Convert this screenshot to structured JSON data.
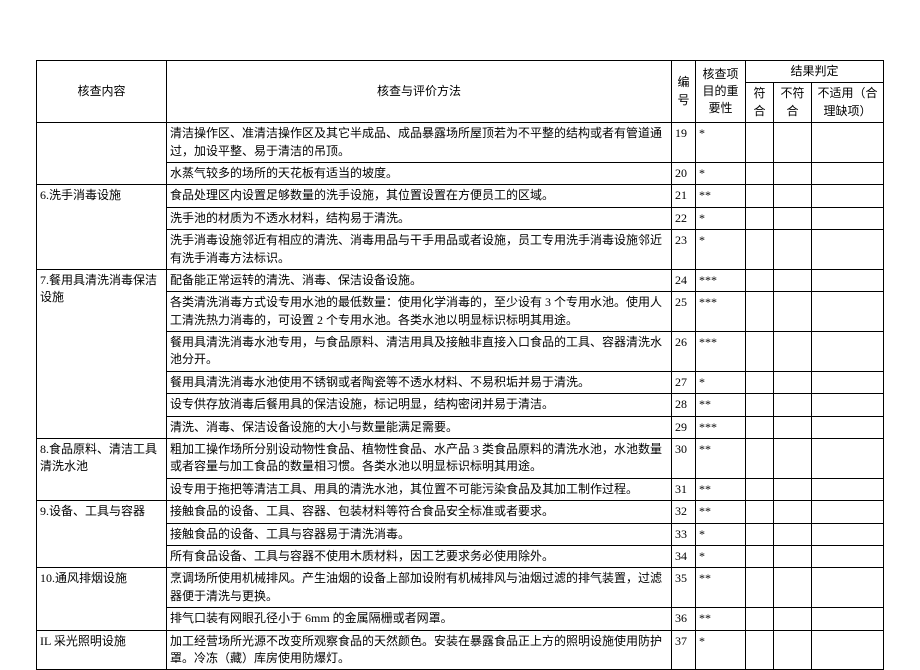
{
  "header": {
    "col1": "核查内容",
    "col2": "核查与评价方法",
    "col3": "编号",
    "col4": "核查项目的重要性",
    "resultGroup": "结果判定",
    "col5": "符合",
    "col6": "不符合",
    "col7": "不适用（合理缺项）"
  },
  "sections": [
    {
      "title": "",
      "rows": [
        {
          "method": "清洁操作区、准清洁操作区及其它半成品、成品暴露场所屋顶若为不平整的结构或者有管道通过，加设平整、易于清洁的吊顶。",
          "no": "19",
          "imp": "*"
        },
        {
          "method": "水蒸气较多的场所的天花板有适当的坡度。",
          "no": "20",
          "imp": "*"
        }
      ]
    },
    {
      "title": "6.洗手消毒设施",
      "rows": [
        {
          "method": "食品处理区内设置足够数量的洗手设施，其位置设置在方便员工的区域。",
          "no": "21",
          "imp": "**"
        },
        {
          "method": "洗手池的材质为不透水材料，结构易于清洗。",
          "no": "22",
          "imp": "*"
        },
        {
          "method": "洗手消毒设施邻近有相应的清洗、消毒用品与干手用品或者设施，员工专用洗手消毒设施邻近有洗手消毒方法标识。",
          "no": "23",
          "imp": "*"
        }
      ]
    },
    {
      "title": "7.餐用具清洗消毒保洁设施",
      "rows": [
        {
          "method": "配备能正常运转的清洗、消毒、保洁设备设施。",
          "no": "24",
          "imp": "***"
        },
        {
          "method": "各类清洗消毒方式设专用水池的最低数量：使用化学消毒的，至少设有 3 个专用水池。使用人工清洗热力消毒的，可设置 2 个专用水池。各类水池以明显标识标明其用途。",
          "no": "25",
          "imp": "***"
        },
        {
          "method": "餐用具清洗消毒水池专用，与食品原料、清洁用具及接触非直接入口食品的工具、容器清洗水池分开。",
          "no": "26",
          "imp": "***"
        },
        {
          "method": "餐用具清洗消毒水池使用不锈钢或者陶瓷等不透水材料、不易积垢并易于清洗。",
          "no": "27",
          "imp": "*"
        },
        {
          "method": "设专供存放消毒后餐用具的保洁设施，标记明显，结构密闭并易于清洁。",
          "no": "28",
          "imp": "**"
        },
        {
          "method": "清洗、消毒、保洁设备设施的大小与数量能满足需要。",
          "no": "29",
          "imp": "***"
        }
      ]
    },
    {
      "title": "8.食品原料、清洁工具清洗水池",
      "rows": [
        {
          "method": "粗加工操作场所分别设动物性食品、植物性食品、水产品 3 类食品原料的清洗水池，水池数量或者容量与加工食品的数量相习惯。各类水池以明显标识标明其用途。",
          "no": "30",
          "imp": "**"
        },
        {
          "method": "设专用于拖把等清洁工具、用具的清洗水池，其位置不可能污染食品及其加工制作过程。",
          "no": "31",
          "imp": "**"
        }
      ]
    },
    {
      "title": "9.设备、工具与容器",
      "rows": [
        {
          "method": "接触食品的设备、工具、容器、包装材料等符合食品安全标准或者要求。",
          "no": "32",
          "imp": "**"
        },
        {
          "method": "接触食品的设备、工具与容器易于清洗消毒。",
          "no": "33",
          "imp": "*"
        },
        {
          "method": "所有食品设备、工具与容器不使用木质材料，因工艺要求务必使用除外。",
          "no": "34",
          "imp": "*"
        }
      ]
    },
    {
      "title": "10.通风排烟设施",
      "rows": [
        {
          "method": "烹调场所使用机械排风。产生油烟的设备上部加设附有机械排风与油烟过滤的排气装置，过滤器便于清洗与更换。",
          "no": "35",
          "imp": "**"
        },
        {
          "method": "排气口装有网眼孔径小于 6mm 的金属隔栅或者网罩。",
          "no": "36",
          "imp": "**"
        }
      ]
    },
    {
      "title": "IL 采光照明设施",
      "rows": [
        {
          "method": "加工经营场所光源不改变所观察食品的天然颜色。安装在暴露食品正上方的照明设施使用防护罩。冷冻（藏）库房使用防爆灯。",
          "no": "37",
          "imp": "*"
        }
      ]
    }
  ]
}
